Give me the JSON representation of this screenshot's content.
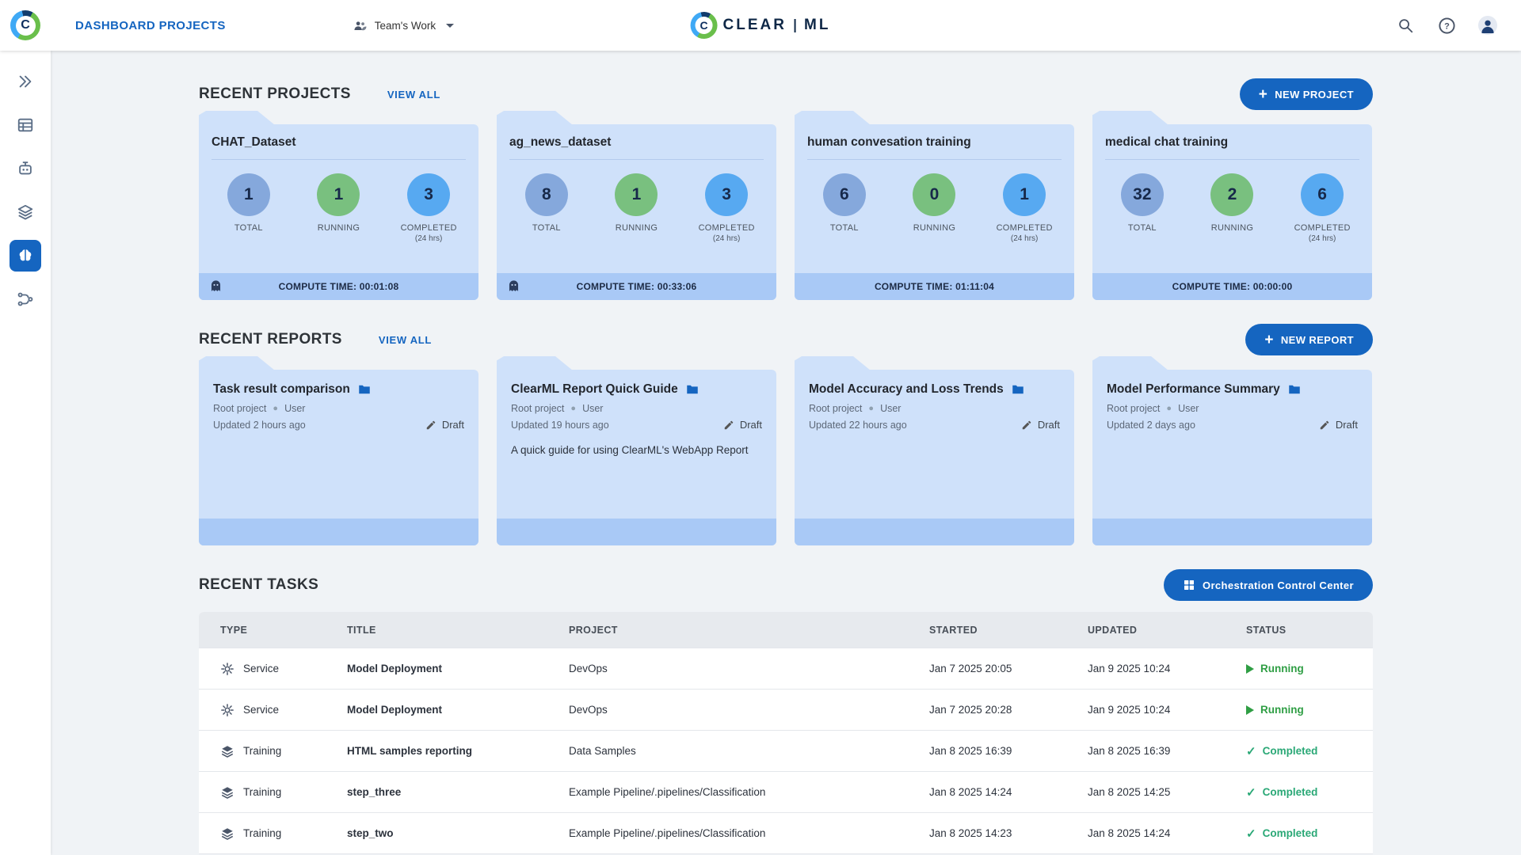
{
  "header": {
    "nav_title": "DASHBOARD PROJECTS",
    "workspace": "Team's Work",
    "logo_text_1": "CLEAR",
    "logo_text_2": "ML",
    "logo_letter": "C"
  },
  "icons": {
    "plus": "+",
    "check": "✓",
    "bullet": "●",
    "help": "?"
  },
  "labels": {
    "total": "TOTAL",
    "running": "RUNNING",
    "completed": "COMPLETED",
    "hrs24": "(24 hrs)"
  },
  "sections": {
    "projects_title": "RECENT PROJECTS",
    "projects_view_all": "VIEW ALL",
    "new_project": "NEW PROJECT",
    "reports_title": "RECENT REPORTS",
    "reports_view_all": "VIEW ALL",
    "new_report": "NEW REPORT",
    "tasks_title": "RECENT TASKS",
    "orchestration": "Orchestration Control Center"
  },
  "projects": [
    {
      "name": "CHAT_Dataset",
      "total": "1",
      "running": "1",
      "completed": "3",
      "compute": "COMPUTE TIME: 00:01:08"
    },
    {
      "name": "ag_news_dataset",
      "total": "8",
      "running": "1",
      "completed": "3",
      "compute": "COMPUTE TIME: 00:33:06"
    },
    {
      "name": "human convesation training",
      "total": "6",
      "running": "0",
      "completed": "1",
      "compute": "COMPUTE TIME: 01:11:04"
    },
    {
      "name": "medical chat training",
      "total": "32",
      "running": "2",
      "completed": "6",
      "compute": "COMPUTE TIME: 00:00:00"
    }
  ],
  "reports": [
    {
      "title": "Task result comparison",
      "project": "Root project",
      "user": "User",
      "updated": "Updated 2 hours ago",
      "status": "Draft",
      "description": ""
    },
    {
      "title": "ClearML Report Quick Guide",
      "project": "Root project",
      "user": "User",
      "updated": "Updated 19 hours ago",
      "status": "Draft",
      "description": "A quick guide for using ClearML's WebApp Report"
    },
    {
      "title": "Model Accuracy and Loss Trends",
      "project": "Root project",
      "user": "User",
      "updated": "Updated 22 hours ago",
      "status": "Draft",
      "description": ""
    },
    {
      "title": "Model Performance Summary",
      "project": "Root project",
      "user": "User",
      "updated": "Updated 2 days ago",
      "status": "Draft",
      "description": ""
    }
  ],
  "tasks": {
    "columns": {
      "type": "TYPE",
      "title": "TITLE",
      "project": "PROJECT",
      "started": "STARTED",
      "updated": "UPDATED",
      "status": "STATUS"
    },
    "rows": [
      {
        "type": "Service",
        "title": "Model Deployment",
        "project": "DevOps",
        "started": "Jan 7 2025 20:05",
        "updated": "Jan 9 2025 10:24",
        "status": "Running"
      },
      {
        "type": "Service",
        "title": "Model Deployment",
        "project": "DevOps",
        "started": "Jan 7 2025 20:28",
        "updated": "Jan 9 2025 10:24",
        "status": "Running"
      },
      {
        "type": "Training",
        "title": "HTML samples reporting",
        "project": "Data Samples",
        "started": "Jan 8 2025 16:39",
        "updated": "Jan 8 2025 16:39",
        "status": "Completed"
      },
      {
        "type": "Training",
        "title": "step_three",
        "project": "Example Pipeline/.pipelines/Classification",
        "started": "Jan 8 2025 14:24",
        "updated": "Jan 8 2025 14:25",
        "status": "Completed"
      },
      {
        "type": "Training",
        "title": "step_two",
        "project": "Example Pipeline/.pipelines/Classification",
        "started": "Jan 8 2025 14:23",
        "updated": "Jan 8 2025 14:24",
        "status": "Completed"
      }
    ]
  },
  "colors": {
    "primary": "#1565c0",
    "card": "#cfe1fa",
    "card_footer": "#a9c9f6",
    "stat_total": "#85a8dc",
    "stat_running": "#79c07f",
    "stat_completed": "#57a9f1",
    "status_running": "#2f9e44",
    "status_completed": "#2aa876"
  }
}
